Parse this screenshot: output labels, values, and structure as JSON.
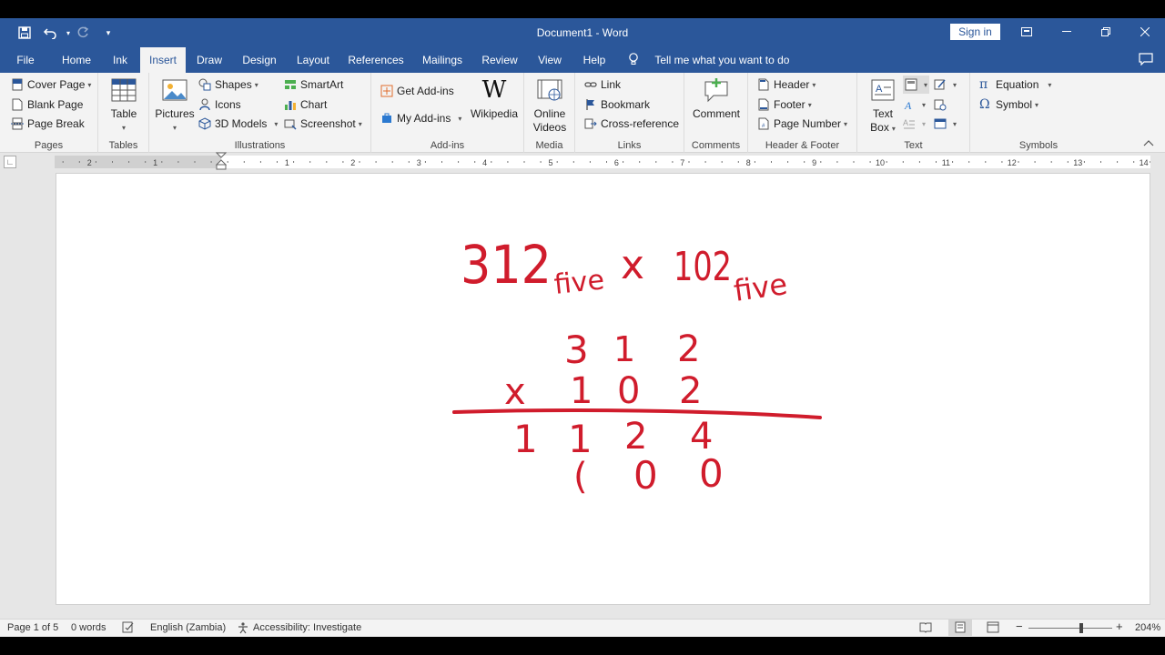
{
  "window": {
    "title": "Document1  -  Word",
    "sign_in": "Sign in"
  },
  "tabs": [
    "File",
    "Home",
    "Ink",
    "Insert",
    "Draw",
    "Design",
    "Layout",
    "References",
    "Mailings",
    "Review",
    "View",
    "Help"
  ],
  "active_tab": "Insert",
  "tell_me": "Tell me what you want to do",
  "ribbon": {
    "pages": {
      "label": "Pages",
      "cover_page": "Cover Page",
      "blank_page": "Blank Page",
      "page_break": "Page Break"
    },
    "tables": {
      "label": "Tables",
      "table": "Table"
    },
    "illustrations": {
      "label": "Illustrations",
      "pictures": "Pictures",
      "shapes": "Shapes",
      "icons": "Icons",
      "models": "3D Models",
      "smartart": "SmartArt",
      "chart": "Chart",
      "screenshot": "Screenshot"
    },
    "addins": {
      "label": "Add-ins",
      "get": "Get Add-ins",
      "my": "My Add-ins",
      "wikipedia": "Wikipedia"
    },
    "media": {
      "label": "Media",
      "online_videos_1": "Online",
      "online_videos_2": "Videos"
    },
    "links": {
      "label": "Links",
      "link": "Link",
      "bookmark": "Bookmark",
      "cross_ref": "Cross-reference"
    },
    "comments": {
      "label": "Comments",
      "comment": "Comment"
    },
    "header_footer": {
      "label": "Header & Footer",
      "header": "Header",
      "footer": "Footer",
      "page_number": "Page Number"
    },
    "text": {
      "label": "Text",
      "text_box_1": "Text",
      "text_box_2": "Box"
    },
    "symbols": {
      "label": "Symbols",
      "equation": "Equation",
      "symbol": "Symbol"
    }
  },
  "ruler_numbers": [
    "2",
    "1",
    "1",
    "2",
    "3",
    "4",
    "5",
    "6",
    "7",
    "8",
    "9",
    "10",
    "11",
    "12",
    "13",
    "14"
  ],
  "handwriting": {
    "line1_a": "312",
    "sub1": "five",
    "times1": "x",
    "line1_b": "102",
    "sub2": "five",
    "row1": [
      "3",
      "1",
      "2"
    ],
    "times2": "x",
    "row2": [
      "1",
      "0",
      "2"
    ],
    "row3": [
      "1",
      "1",
      "2",
      "4"
    ],
    "row4": [
      "(",
      "0",
      "0"
    ],
    "ink_color": "#d01c2c"
  },
  "status": {
    "page": "Page 1 of 5",
    "words": "0 words",
    "language": "English (Zambia)",
    "accessibility": "Accessibility: Investigate",
    "zoom": "204%",
    "zoom_level": 204
  },
  "colors": {
    "accent": "#2b579a"
  }
}
